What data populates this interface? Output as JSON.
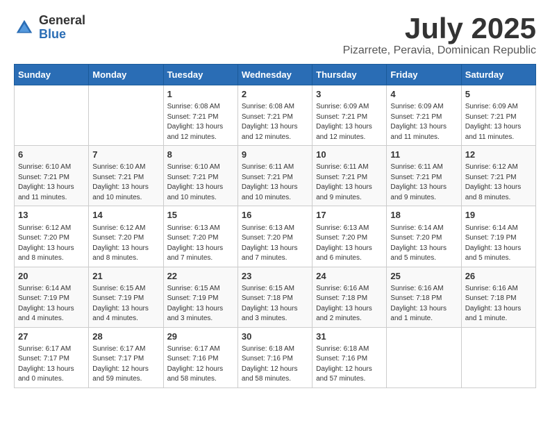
{
  "header": {
    "logo_general": "General",
    "logo_blue": "Blue",
    "month": "July 2025",
    "location": "Pizarrete, Peravia, Dominican Republic"
  },
  "days_of_week": [
    "Sunday",
    "Monday",
    "Tuesday",
    "Wednesday",
    "Thursday",
    "Friday",
    "Saturday"
  ],
  "weeks": [
    [
      {
        "day": "",
        "info": ""
      },
      {
        "day": "",
        "info": ""
      },
      {
        "day": "1",
        "info": "Sunrise: 6:08 AM\nSunset: 7:21 PM\nDaylight: 13 hours\nand 12 minutes."
      },
      {
        "day": "2",
        "info": "Sunrise: 6:08 AM\nSunset: 7:21 PM\nDaylight: 13 hours\nand 12 minutes."
      },
      {
        "day": "3",
        "info": "Sunrise: 6:09 AM\nSunset: 7:21 PM\nDaylight: 13 hours\nand 12 minutes."
      },
      {
        "day": "4",
        "info": "Sunrise: 6:09 AM\nSunset: 7:21 PM\nDaylight: 13 hours\nand 11 minutes."
      },
      {
        "day": "5",
        "info": "Sunrise: 6:09 AM\nSunset: 7:21 PM\nDaylight: 13 hours\nand 11 minutes."
      }
    ],
    [
      {
        "day": "6",
        "info": "Sunrise: 6:10 AM\nSunset: 7:21 PM\nDaylight: 13 hours\nand 11 minutes."
      },
      {
        "day": "7",
        "info": "Sunrise: 6:10 AM\nSunset: 7:21 PM\nDaylight: 13 hours\nand 10 minutes."
      },
      {
        "day": "8",
        "info": "Sunrise: 6:10 AM\nSunset: 7:21 PM\nDaylight: 13 hours\nand 10 minutes."
      },
      {
        "day": "9",
        "info": "Sunrise: 6:11 AM\nSunset: 7:21 PM\nDaylight: 13 hours\nand 10 minutes."
      },
      {
        "day": "10",
        "info": "Sunrise: 6:11 AM\nSunset: 7:21 PM\nDaylight: 13 hours\nand 9 minutes."
      },
      {
        "day": "11",
        "info": "Sunrise: 6:11 AM\nSunset: 7:21 PM\nDaylight: 13 hours\nand 9 minutes."
      },
      {
        "day": "12",
        "info": "Sunrise: 6:12 AM\nSunset: 7:21 PM\nDaylight: 13 hours\nand 8 minutes."
      }
    ],
    [
      {
        "day": "13",
        "info": "Sunrise: 6:12 AM\nSunset: 7:20 PM\nDaylight: 13 hours\nand 8 minutes."
      },
      {
        "day": "14",
        "info": "Sunrise: 6:12 AM\nSunset: 7:20 PM\nDaylight: 13 hours\nand 8 minutes."
      },
      {
        "day": "15",
        "info": "Sunrise: 6:13 AM\nSunset: 7:20 PM\nDaylight: 13 hours\nand 7 minutes."
      },
      {
        "day": "16",
        "info": "Sunrise: 6:13 AM\nSunset: 7:20 PM\nDaylight: 13 hours\nand 7 minutes."
      },
      {
        "day": "17",
        "info": "Sunrise: 6:13 AM\nSunset: 7:20 PM\nDaylight: 13 hours\nand 6 minutes."
      },
      {
        "day": "18",
        "info": "Sunrise: 6:14 AM\nSunset: 7:20 PM\nDaylight: 13 hours\nand 5 minutes."
      },
      {
        "day": "19",
        "info": "Sunrise: 6:14 AM\nSunset: 7:19 PM\nDaylight: 13 hours\nand 5 minutes."
      }
    ],
    [
      {
        "day": "20",
        "info": "Sunrise: 6:14 AM\nSunset: 7:19 PM\nDaylight: 13 hours\nand 4 minutes."
      },
      {
        "day": "21",
        "info": "Sunrise: 6:15 AM\nSunset: 7:19 PM\nDaylight: 13 hours\nand 4 minutes."
      },
      {
        "day": "22",
        "info": "Sunrise: 6:15 AM\nSunset: 7:19 PM\nDaylight: 13 hours\nand 3 minutes."
      },
      {
        "day": "23",
        "info": "Sunrise: 6:15 AM\nSunset: 7:18 PM\nDaylight: 13 hours\nand 3 minutes."
      },
      {
        "day": "24",
        "info": "Sunrise: 6:16 AM\nSunset: 7:18 PM\nDaylight: 13 hours\nand 2 minutes."
      },
      {
        "day": "25",
        "info": "Sunrise: 6:16 AM\nSunset: 7:18 PM\nDaylight: 13 hours\nand 1 minute."
      },
      {
        "day": "26",
        "info": "Sunrise: 6:16 AM\nSunset: 7:18 PM\nDaylight: 13 hours\nand 1 minute."
      }
    ],
    [
      {
        "day": "27",
        "info": "Sunrise: 6:17 AM\nSunset: 7:17 PM\nDaylight: 13 hours\nand 0 minutes."
      },
      {
        "day": "28",
        "info": "Sunrise: 6:17 AM\nSunset: 7:17 PM\nDaylight: 12 hours\nand 59 minutes."
      },
      {
        "day": "29",
        "info": "Sunrise: 6:17 AM\nSunset: 7:16 PM\nDaylight: 12 hours\nand 58 minutes."
      },
      {
        "day": "30",
        "info": "Sunrise: 6:18 AM\nSunset: 7:16 PM\nDaylight: 12 hours\nand 58 minutes."
      },
      {
        "day": "31",
        "info": "Sunrise: 6:18 AM\nSunset: 7:16 PM\nDaylight: 12 hours\nand 57 minutes."
      },
      {
        "day": "",
        "info": ""
      },
      {
        "day": "",
        "info": ""
      }
    ]
  ]
}
